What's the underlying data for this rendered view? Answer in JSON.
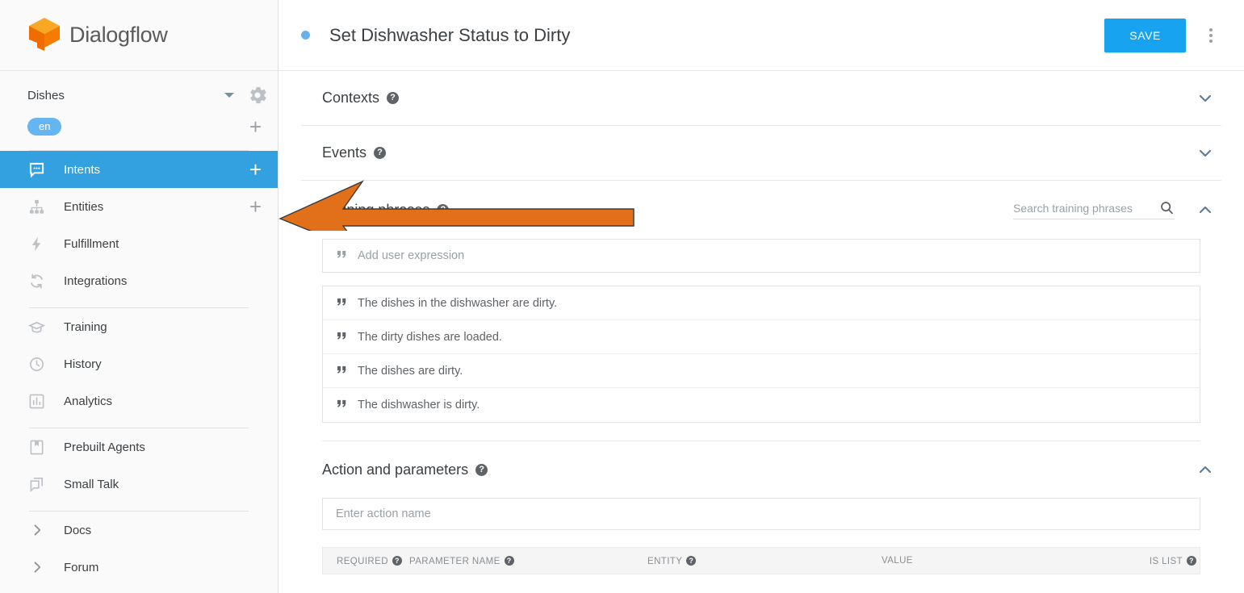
{
  "brand": {
    "name": "Dialogflow",
    "logo_icon": "dialogflow-cube-icon",
    "accent": "#ef6c00"
  },
  "sidebar": {
    "agent": {
      "name": "Dishes",
      "caret_icon": "chevron-down-icon",
      "settings_icon": "gear-icon"
    },
    "language": {
      "chip": "en",
      "add_icon": "plus-icon",
      "chip_color": "#64b5f0"
    },
    "nav": [
      {
        "label": "Intents",
        "icon": "speech-bubble-icon",
        "active": true,
        "add": "+"
      },
      {
        "label": "Entities",
        "icon": "hierarchy-icon",
        "active": false,
        "add": "+"
      },
      {
        "label": "Fulfillment",
        "icon": "lightning-bolt-icon",
        "active": false,
        "add": ""
      },
      {
        "label": "Integrations",
        "icon": "refresh-icon",
        "active": false,
        "add": ""
      }
    ],
    "nav2": [
      {
        "label": "Training",
        "icon": "graduation-cap-icon"
      },
      {
        "label": "History",
        "icon": "clock-icon"
      },
      {
        "label": "Analytics",
        "icon": "bar-chart-icon"
      }
    ],
    "nav3": [
      {
        "label": "Prebuilt Agents",
        "icon": "book-icon"
      },
      {
        "label": "Small Talk",
        "icon": "chat-copy-icon"
      }
    ],
    "nav4": [
      {
        "label": "Docs",
        "icon": "chevron-right-icon"
      },
      {
        "label": "Forum",
        "icon": "chevron-right-icon"
      }
    ]
  },
  "header": {
    "status_dot": "status-dot",
    "title": "Set Dishwasher Status to Dirty",
    "save_label": "SAVE",
    "save_color": "#18a3f0",
    "menu_icon": "more-vertical-icon"
  },
  "sections": {
    "contexts": {
      "title": "Contexts",
      "help": "?",
      "chevron": "chevron-down-icon",
      "expanded": false
    },
    "events": {
      "title": "Events",
      "help": "?",
      "chevron": "chevron-down-icon",
      "expanded": false
    },
    "training_phrases": {
      "title": "Training phrases",
      "help": "?",
      "chevron": "chevron-up-icon",
      "expanded": true,
      "search_placeholder": "Search training phrases",
      "search_value": "",
      "search_icon": "search-icon",
      "add_placeholder": "Add user expression",
      "quote_icon": "quote-icon",
      "phrases": [
        "The dishes in the dishwasher are dirty.",
        "The dirty dishes are loaded.",
        "The dishes are dirty.",
        "The dishwasher is dirty."
      ]
    },
    "action_parameters": {
      "title": "Action and parameters",
      "help": "?",
      "chevron": "chevron-up-icon",
      "expanded": true,
      "action_placeholder": "Enter action name",
      "action_value": "",
      "columns": [
        {
          "label": "REQUIRED",
          "help": "?"
        },
        {
          "label": "PARAMETER NAME",
          "help": "?"
        },
        {
          "label": "ENTITY",
          "help": "?"
        },
        {
          "label": "VALUE",
          "help": ""
        },
        {
          "label": "IS LIST",
          "help": "?"
        }
      ]
    }
  },
  "annotation": {
    "type": "arrow",
    "direction": "left",
    "color": "#e2701a",
    "outline": "#3a3a3a",
    "points_at": "Training phrases"
  }
}
